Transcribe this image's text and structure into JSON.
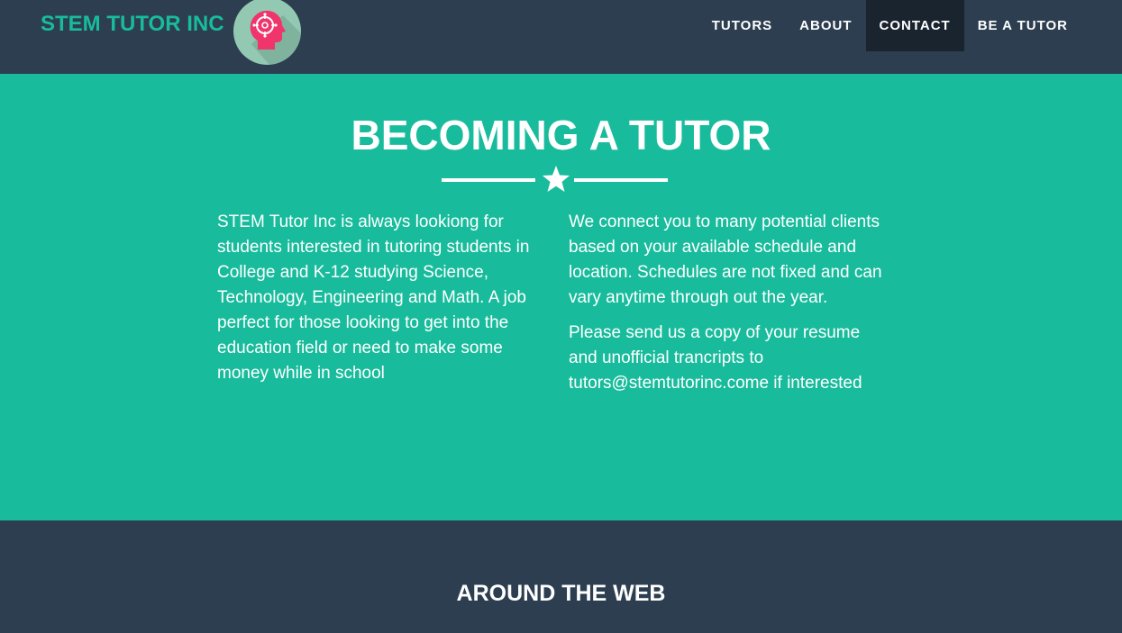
{
  "navbar": {
    "brand": "STEM TUTOR INC",
    "logo_icon": "brain-head-icon",
    "items": [
      {
        "label": "TUTORS",
        "active": false
      },
      {
        "label": "ABOUT",
        "active": false
      },
      {
        "label": "CONTACT",
        "active": true
      },
      {
        "label": "BE A TUTOR",
        "active": false
      }
    ]
  },
  "hero": {
    "title": "BECOMING A TUTOR",
    "divider_icon": "star-icon",
    "left_paragraph": "STEM Tutor Inc is always lookiong for students interested in tutoring students in College and K-12 studying Science, Technology, Engineering and Math. A job perfect for those looking to get into the education field or need to make some money while in school",
    "right_paragraph_1": "We connect you to many potential clients based on your available schedule and location. Schedules are not fixed and can vary anytime through out the year.",
    "right_paragraph_2": "Please send us a copy of your resume and unofficial trancripts to tutors@stemtutorinc.come if interested"
  },
  "footer": {
    "title": "AROUND THE WEB"
  },
  "colors": {
    "navbar_bg": "#2c3e50",
    "accent": "#18bc9c",
    "active_nav_bg": "#1a242f",
    "text": "#ffffff",
    "logo_circle": "#93c9b3",
    "logo_head": "#f0346c"
  }
}
